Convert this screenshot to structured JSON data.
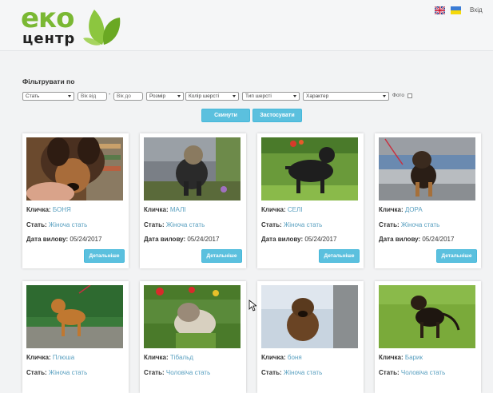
{
  "header": {
    "logo_top": "еко",
    "logo_bottom": "центр",
    "login": "Вхід",
    "languages": [
      "uk-flag-icon",
      "ua-flag-icon"
    ]
  },
  "filters": {
    "title": "Фільтрувати по",
    "sex": "Стать",
    "age_from": "Вік від",
    "age_to": "Вік до",
    "size": "Розмір",
    "color": "Колір шерсті",
    "fur": "Тип шерсті",
    "character": "Характер",
    "photo": "Фото",
    "reset": "Скинути",
    "apply": "Застосувати"
  },
  "labels": {
    "name": "Кличка:",
    "sex": "Стать:",
    "date": "Дата вилову:",
    "details": "Детальніше"
  },
  "cards": [
    {
      "name": "БОНЯ",
      "sex": "Жіноча стать",
      "date": "05/24/2017"
    },
    {
      "name": "МАЛІ",
      "sex": "Жіноча стать",
      "date": "05/24/2017"
    },
    {
      "name": "СЕЛІ",
      "sex": "Жіноча стать",
      "date": "05/24/2017"
    },
    {
      "name": "ДОРА",
      "sex": "Жіноча стать",
      "date": "05/24/2017"
    },
    {
      "name": "Плюша",
      "sex": "Жіноча стать"
    },
    {
      "name": "Тібальд",
      "sex": "Чоловіча стать"
    },
    {
      "name": "боня",
      "sex": "Жіноча стать"
    },
    {
      "name": "Барик",
      "sex": "Чоловіча стать"
    }
  ],
  "colors": {
    "brand_green": "#7ab833",
    "accent_blue": "#5bc0de"
  }
}
